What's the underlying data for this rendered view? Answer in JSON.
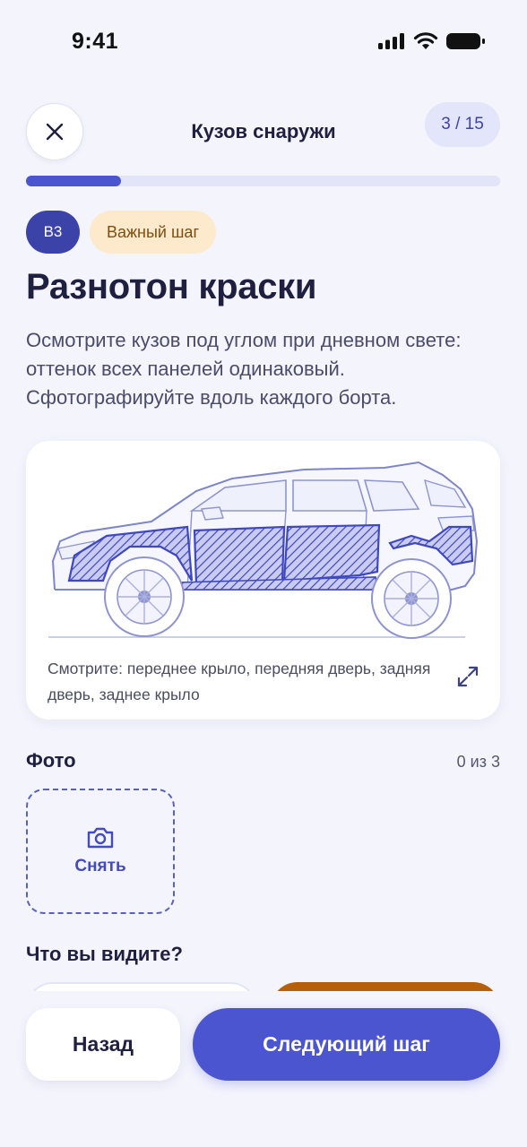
{
  "status_bar": {
    "time": "9:41"
  },
  "header": {
    "title": "Кузов снаружи",
    "step_counter": "3 / 15",
    "progress": 0.2
  },
  "step": {
    "code": "B3",
    "badge": "Важный шаг",
    "title": "Разнотон краски",
    "description": "Осмотрите кузов под углом при дневном свете: оттенок всех панелей одинаковый. Сфотографируйте вдоль каждого борта."
  },
  "illustration": {
    "caption": "Смотрите: переднее крыло, передняя дверь, задняя дверь, заднее крыло",
    "highlight_color": "#3f48c0"
  },
  "photos": {
    "label": "Фото",
    "count": "0 из 3",
    "capture_label": "Снять"
  },
  "question": {
    "label": "Что вы видите?"
  },
  "footer": {
    "back_label": "Назад",
    "next_label": "Следующий шаг"
  },
  "colors": {
    "accent": "#4b55cf",
    "background": "#f4f4fd",
    "warning": "#b65e0a"
  }
}
